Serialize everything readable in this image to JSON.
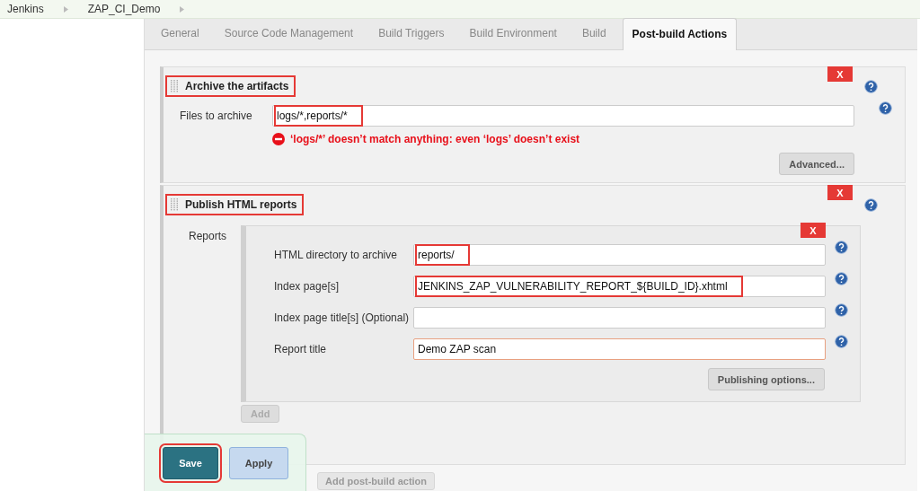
{
  "breadcrumbs": [
    {
      "label": "Jenkins"
    },
    {
      "label": "ZAP_CI_Demo"
    }
  ],
  "tabs": [
    {
      "label": "General",
      "selected": false
    },
    {
      "label": "Source Code Management",
      "selected": false
    },
    {
      "label": "Build Triggers",
      "selected": false
    },
    {
      "label": "Build Environment",
      "selected": false
    },
    {
      "label": "Build",
      "selected": false
    },
    {
      "label": "Post-build Actions",
      "selected": true
    }
  ],
  "sections": [
    {
      "title": "Archive the artifacts",
      "highlighted": true,
      "delete_button": "X",
      "fields": [
        {
          "label": "Files to archive",
          "value": "logs/*,reports/*",
          "highlighted": true
        }
      ],
      "error": "‘logs/*’ doesn’t match anything: even ‘logs’ doesn’t exist",
      "button": "Advanced..."
    },
    {
      "title": "Publish HTML reports",
      "highlighted": true,
      "delete_button": "X",
      "group_label": "Reports",
      "report": {
        "delete_button": "X",
        "fields": [
          {
            "label": "HTML directory to archive",
            "value": "reports/",
            "highlighted": true,
            "focused": false
          },
          {
            "label": "Index page[s]",
            "value": "JENKINS_ZAP_VULNERABILITY_REPORT_${BUILD_ID}.xhtml",
            "highlighted": true,
            "focused": false
          },
          {
            "label": "Index page title[s] (Optional)",
            "highlighted": false,
            "focused": false
          },
          {
            "label": "Report title",
            "value": "Demo ZAP scan",
            "highlighted": false,
            "focused": true
          }
        ],
        "button": "Publishing options..."
      },
      "add_button": "Add"
    }
  ],
  "add_action_button": "Add post-build action",
  "save_bar": {
    "buttons": [
      {
        "label": "Save",
        "kind": "primary",
        "highlighted": true
      },
      {
        "label": "Apply",
        "kind": "secondary",
        "highlighted": false
      }
    ]
  }
}
